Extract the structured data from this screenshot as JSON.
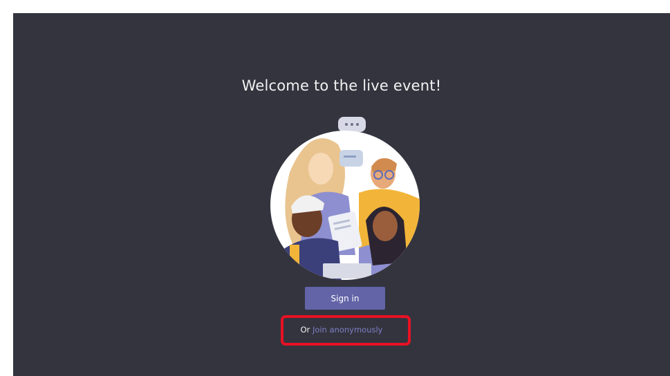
{
  "welcome": {
    "title": "Welcome to the live event!"
  },
  "illustration": {
    "icon": "people-group-illustration"
  },
  "actions": {
    "sign_in_label": "Sign in",
    "or_label": "Or",
    "join_anonymously_label": "Join anonymously"
  },
  "colors": {
    "background": "#34343f",
    "accent": "#6264a7",
    "link": "#7e7fc4",
    "highlight": "#e81123"
  }
}
